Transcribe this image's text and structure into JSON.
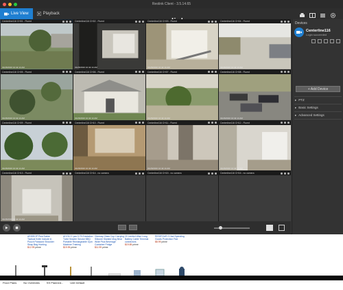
{
  "window": {
    "title": "Reolink Client - 3.5.14.65"
  },
  "toolbar": {
    "live_view_label": "Live View",
    "playback_label": "Playback",
    "brand": "reolink"
  },
  "cameras": [
    {
      "name": "Centerline116 CH01 - Fluent",
      "ts": "01/26/2016 10:42:14 AM",
      "scene": "yard"
    },
    {
      "name": "Centerline116 CH02 - Fluent",
      "ts": "01/26/2016 10:42:14 AM",
      "scene": "interior-dark"
    },
    {
      "name": "Centerline116 CH03 - Fluent",
      "ts": "01/26/2016 10:42:14 AM",
      "scene": "porch"
    },
    {
      "name": "Centerline116 CH04 - Fluent",
      "ts": "01/26/2016 10:42:14 AM",
      "scene": "driveway"
    },
    {
      "name": "Centerline116 CH05 - Fluent",
      "ts": "01/26/2016 10:42:14 AM",
      "scene": "backyard"
    },
    {
      "name": "Centerline116 CH06 - Fluent",
      "ts": "01/26/2016 10:42:14 AM",
      "scene": "house"
    },
    {
      "name": "Centerline116 CH07 - Fluent",
      "ts": "01/26/2016 10:42:14 AM",
      "scene": "garden"
    },
    {
      "name": "Centerline116 CH08 - Fluent",
      "ts": "01/26/2016 10:42:14 AM",
      "scene": "parking"
    },
    {
      "name": "Centerline116 CH09 - Fluent",
      "ts": "01/26/2016 10:42:14 AM",
      "scene": "trees"
    },
    {
      "name": "Centerline116 CH10 - Fluent",
      "ts": "01/26/2016 10:42:14 AM",
      "scene": "lobby"
    },
    {
      "name": "Centerline116 CH11 - Fluent",
      "ts": "01/26/2016 10:42:14 AM",
      "scene": "hall"
    },
    {
      "name": "Centerline116 CH12 - Fluent",
      "ts": "01/26/2016 10:42:14 AM",
      "scene": "office"
    },
    {
      "name": "Centerline116 CH13 - Fluent",
      "ts": "01/26/2016 10:42:14 AM",
      "scene": "atrium"
    },
    {
      "name": "Centerline116 CH14 - no camera",
      "ts": "",
      "scene": "empty"
    },
    {
      "name": "Centerline116 CH15 - no camera",
      "ts": "",
      "scene": "empty"
    },
    {
      "name": "Centerline116 CH16 - no camera",
      "ts": "",
      "scene": "empty"
    }
  ],
  "sidebar": {
    "devices_label": "Devices",
    "device_name": "Centerline116",
    "device_status": "Login succeeded",
    "add_device_label": "+ Add Device",
    "sections": [
      "PTZ",
      "Basic Settings",
      "Advanced Settings"
    ]
  },
  "web": {
    "ads": [
      {
        "title": "ARISEOP Pest Sabre Tactical Knife Include in Pouch Paracord Shoulder Strap Bag Hunting",
        "price": "$12.99",
        "note": "prime"
      },
      {
        "title": "AIYOLI 1 pcs 0.75 Emulation Tube Heavier Smoke BBQ Portable Rechargeable Gym Machine Training",
        "price": "$19.95",
        "note": "prime"
      },
      {
        "title": "Glorway Glass Cup Carrying Silicone Slanted Mug Bear Wide Plus Beverage Container Fridge",
        "price": "$11.99",
        "note": "prime"
      },
      {
        "title": "20 Limited Wise Long Battery Cable Terminal connectors",
        "price": "$19.85",
        "note": "prime"
      },
      {
        "title": "RESIFOUR 2 Had Spending Goods Protection Pad",
        "price": "$8.99",
        "note": "prime"
      }
    ],
    "tabs": [
      "Floor Plans",
      "No Overrides",
      "SS Planned...",
      "Unit Default"
    ]
  }
}
